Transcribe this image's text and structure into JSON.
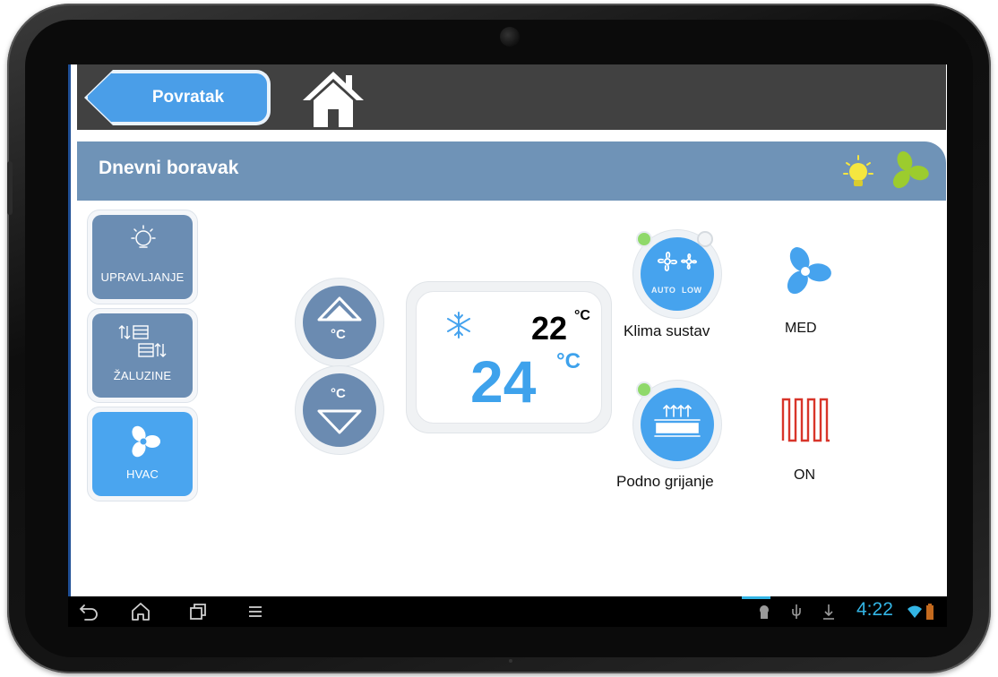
{
  "topbar": {
    "back_label": "Povratak",
    "home_icon": "home-icon"
  },
  "room": {
    "title": "Dnevni boravak",
    "status_icons": [
      "bulb-icon",
      "fan-icon"
    ],
    "colors": {
      "bulb": "#f5e640",
      "fan": "#9ccc2e"
    }
  },
  "nav": {
    "items": [
      {
        "label": "UPRAVLJANJE",
        "icon": "bulb-outline-icon",
        "active": false
      },
      {
        "label": "ŽALUZINE",
        "icon": "blinds-icon",
        "active": false
      },
      {
        "label": "HVAC",
        "icon": "fan-icon",
        "active": true
      }
    ]
  },
  "thermostat": {
    "set_temp": "22",
    "set_unit": "°C",
    "current_temp": "24",
    "current_unit": "°C",
    "mode_icon": "snowflake-icon",
    "up_label": "°C",
    "down_label": "°C"
  },
  "devices": {
    "klima": {
      "label": "Klima sustav",
      "badge_left": "AUTO",
      "badge_right": "LOW",
      "status": "MED",
      "status_icon": "fan-icon"
    },
    "podno": {
      "label": "Podno grijanje",
      "status": "ON",
      "status_icon": "heater-icon"
    }
  },
  "system": {
    "time": "4:22",
    "accent": "#33b5e5"
  }
}
